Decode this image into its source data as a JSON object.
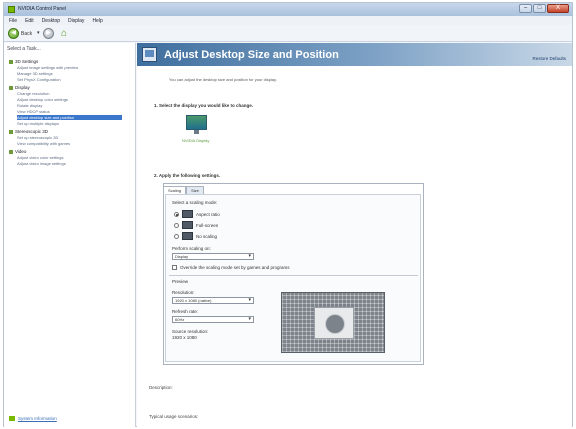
{
  "window": {
    "title": "NVIDIA Control Panel",
    "buttons": {
      "minimize": "–",
      "maximize": "□",
      "close": "X"
    }
  },
  "menubar": [
    "File",
    "Edit",
    "Desktop",
    "Display",
    "Help"
  ],
  "toolbar": {
    "back_label": "Back",
    "back_dropdown": "▾"
  },
  "sidebar": {
    "header": "Select a Task...",
    "categories": [
      {
        "label": "3D Settings",
        "items": [
          "Adjust image settings with preview",
          "Manage 3D settings",
          "Set PhysX Configuration"
        ]
      },
      {
        "label": "Display",
        "items": [
          "Change resolution",
          "Adjust desktop color settings",
          "Rotate display",
          "View HDCP status",
          "Adjust desktop size and position",
          "Set up multiple displays"
        ]
      },
      {
        "label": "Stereoscopic 3D",
        "items": [
          "Set up stereoscopic 3D",
          "View compatibility with games"
        ]
      },
      {
        "label": "Video",
        "items": [
          "Adjust video color settings",
          "Adjust video image settings"
        ]
      }
    ],
    "selected_item": "Adjust desktop size and position",
    "system_info": "System Information"
  },
  "content": {
    "title": "Adjust Desktop Size and Position",
    "restore_defaults": "Restore Defaults",
    "description": "You can adjust the desktop size and position for your display.",
    "step1": "1. Select the display you would like to change.",
    "display_label": "NVIDIA Display",
    "step2": "2. Apply the following settings.",
    "tabs": [
      "Scaling",
      "Size"
    ],
    "active_tab": "Scaling",
    "scaling_mode_label": "Select a scaling mode:",
    "modes": [
      {
        "label": "Aspect ratio",
        "selected": true
      },
      {
        "label": "Full-screen",
        "selected": false
      },
      {
        "label": "No scaling",
        "selected": false
      }
    ],
    "perform_on_label": "Perform scaling on:",
    "perform_on_value": "Display",
    "override_label": "Override the scaling mode set by games and programs",
    "preview_label": "Preview",
    "resolution_label": "Resolution:",
    "resolution_value": "1920 x 1080 (native)",
    "refresh_label": "Refresh rate:",
    "refresh_value": "60Hz",
    "source_label": "Source resolution:",
    "source_value": "1920 x 1080",
    "description_label": "Description:",
    "usage_label": "Typical usage scenarios:"
  }
}
